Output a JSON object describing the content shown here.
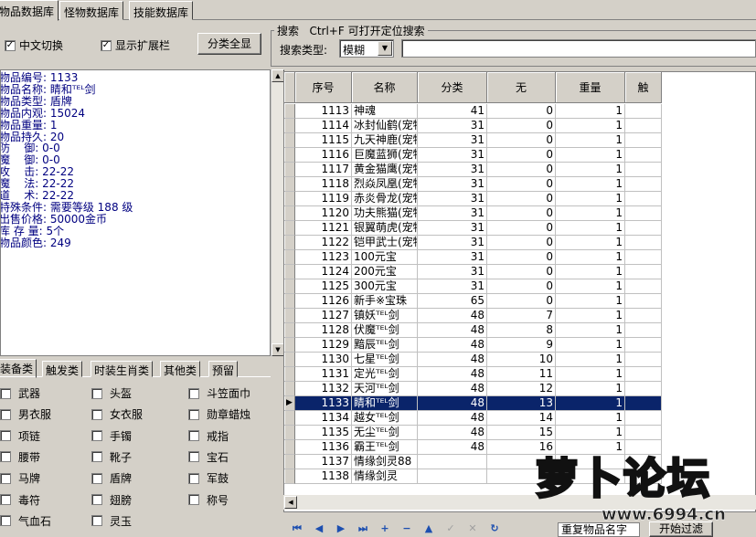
{
  "tabs": [
    {
      "label": "物品数据库",
      "active": true
    },
    {
      "label": "怪物数据库",
      "active": false
    },
    {
      "label": "技能数据库",
      "active": false
    }
  ],
  "toolbar": {
    "chinese_switch": {
      "label": "中文切换",
      "checked": true
    },
    "show_ext": {
      "label": "显示扩展栏",
      "checked": true
    },
    "show_all_button": "分类全显",
    "search_group_title": "搜索   Ctrl+F 可打开定位搜索",
    "search_type_label": "搜索类型:",
    "search_type_value": "模糊",
    "search_text": ""
  },
  "info_lines": [
    "物品编号: 1133",
    "物品名称: 睛和ᵀᴱᴸ剑",
    "物品类型: 盾牌",
    "物品内观: 15024",
    "物品重量: 1",
    "物品持久: 20",
    "防    御: 0-0",
    "魔    御: 0-0",
    "攻    击: 22-22",
    "魔    法: 22-22",
    "道    术: 22-22",
    "特殊条件: 需要等级 188 级",
    "出售价格: 50000金币",
    "库 存 量: 5个",
    "物品颜色: 249"
  ],
  "category_tabs": [
    "装备类",
    "触发类",
    "时装生肖类",
    "其他类",
    "预留"
  ],
  "category_items": [
    [
      "武器",
      "头盔",
      "斗笠面巾"
    ],
    [
      "男衣服",
      "女衣服",
      "勋章蜡烛"
    ],
    [
      "项链",
      "手镯",
      "戒指"
    ],
    [
      "腰带",
      "靴子",
      "宝石"
    ],
    [
      "马牌",
      "盾牌",
      "军鼓"
    ],
    [
      "毒符",
      "翅膀",
      "称号"
    ],
    [
      "气血石",
      "灵玉",
      ""
    ]
  ],
  "grid": {
    "headers": [
      "序号",
      "名称",
      "分类",
      "无",
      "重量",
      "触"
    ],
    "selected_id": "1133",
    "rows": [
      [
        "1113",
        "神魂",
        "41",
        "0",
        "1"
      ],
      [
        "1114",
        "冰封仙鹤(宠物蛋)",
        "31",
        "0",
        "1"
      ],
      [
        "1115",
        "九天神鹿(宠物蛋)",
        "31",
        "0",
        "1"
      ],
      [
        "1116",
        "巨魔蓝狮(宠物蛋)",
        "31",
        "0",
        "1"
      ],
      [
        "1117",
        "黄金猫鹰(宠物蛋)",
        "31",
        "0",
        "1"
      ],
      [
        "1118",
        "烈焱凤凰(宠物蛋)",
        "31",
        "0",
        "1"
      ],
      [
        "1119",
        "赤炎骨龙(宠物蛋)",
        "31",
        "0",
        "1"
      ],
      [
        "1120",
        "功夫熊猫(宠物蛋)",
        "31",
        "0",
        "1"
      ],
      [
        "1121",
        "银翼萌虎(宠物蛋)",
        "31",
        "0",
        "1"
      ],
      [
        "1122",
        "铠甲武士(宠物蛋)",
        "31",
        "0",
        "1"
      ],
      [
        "1123",
        "100元宝",
        "31",
        "0",
        "1"
      ],
      [
        "1124",
        "200元宝",
        "31",
        "0",
        "1"
      ],
      [
        "1125",
        "300元宝",
        "31",
        "0",
        "1"
      ],
      [
        "1126",
        "新手※宝珠",
        "65",
        "0",
        "1"
      ],
      [
        "1127",
        "镇妖ᵀᴱᴸ剑",
        "48",
        "7",
        "1"
      ],
      [
        "1128",
        "伏魔ᵀᴱᴸ剑",
        "48",
        "8",
        "1"
      ],
      [
        "1129",
        "黯辰ᵀᴱᴸ剑",
        "48",
        "9",
        "1"
      ],
      [
        "1130",
        "七星ᵀᴱᴸ剑",
        "48",
        "10",
        "1"
      ],
      [
        "1131",
        "定光ᵀᴱᴸ剑",
        "48",
        "11",
        "1"
      ],
      [
        "1132",
        "天河ᵀᴱᴸ剑",
        "48",
        "12",
        "1"
      ],
      [
        "1133",
        "睛和ᵀᴱᴸ剑",
        "48",
        "13",
        "1"
      ],
      [
        "1134",
        "越女ᵀᴱᴸ剑",
        "48",
        "14",
        "1"
      ],
      [
        "1135",
        "无尘ᵀᴱᴸ剑",
        "48",
        "15",
        "1"
      ],
      [
        "1136",
        "霸王ᵀᴱᴸ剑",
        "48",
        "16",
        "1"
      ],
      [
        "1137",
        "情缘剑灵88",
        "",
        "",
        ""
      ],
      [
        "1138",
        "情缘剑灵",
        "",
        "",
        ""
      ]
    ]
  },
  "nav": {
    "dropdown_value": "重复物品名字",
    "button_label": "开始过滤"
  },
  "watermark": {
    "title": "萝卜论坛",
    "url": "www.6994.cn"
  }
}
